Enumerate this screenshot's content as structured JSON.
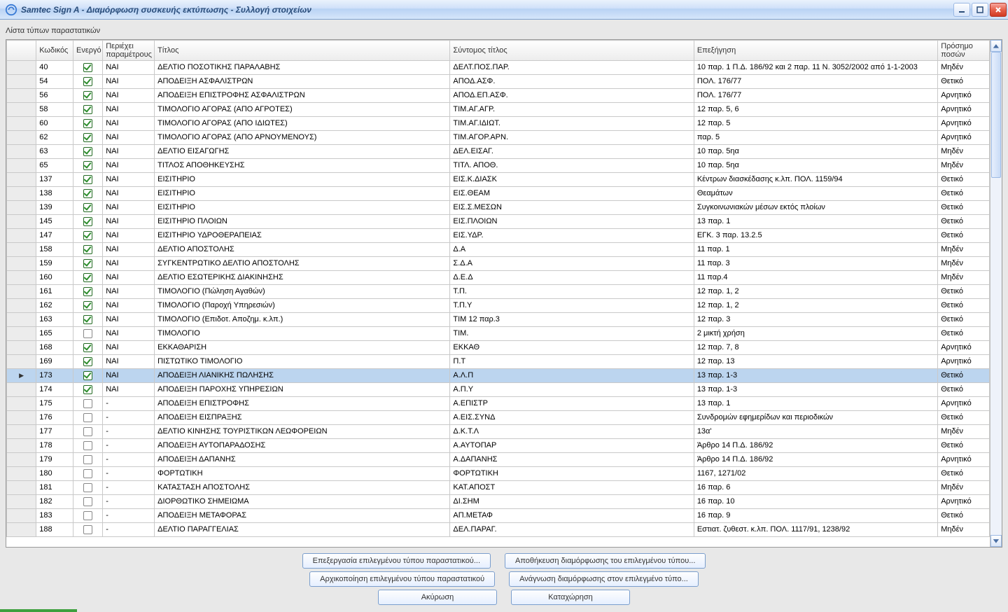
{
  "window": {
    "title": "Samtec Sign A - Διαμόρφωση συσκευής εκτύπωσης - Συλλογή στοιχείων"
  },
  "labels": {
    "list_title": "Λίστα τύπων παραστατικών"
  },
  "columns": {
    "code": "Κωδικός",
    "active": "Ενεργό",
    "has_params": "Περιέχει παραμέτρους",
    "title": "Τίτλος",
    "short": "Σύντομος τίτλος",
    "expl": "Επεξήγηση",
    "sign": "Πρόσημο ποσών"
  },
  "rows": [
    {
      "code": "40",
      "active": true,
      "has": "ΝΑΙ",
      "title": "ΔΕΛΤΙΟ ΠΟΣΟΤΙΚΗΣ ΠΑΡΑΛΑΒΗΣ",
      "short": "ΔΕΛΤ.ΠΟΣ.ΠΑΡ.",
      "expl": "10 παρ. 1 Π.Δ. 186/92 και 2 παρ. 11 Ν. 3052/2002 από 1-1-2003",
      "sign": "Μηδέν"
    },
    {
      "code": "54",
      "active": true,
      "has": "ΝΑΙ",
      "title": "ΑΠΟΔΕΙΞΗ ΑΣΦΑΛΙΣΤΡΩΝ",
      "short": "ΑΠΟΔ.ΑΣΦ.",
      "expl": "ΠΟΛ. 176/77",
      "sign": "Θετικό"
    },
    {
      "code": "56",
      "active": true,
      "has": "ΝΑΙ",
      "title": "ΑΠΟΔΕΙΞΗ ΕΠΙΣΤΡΟΦΗΣ ΑΣΦΑΛΙΣΤΡΩΝ",
      "short": "ΑΠΟΔ.ΕΠ.ΑΣΦ.",
      "expl": "ΠΟΛ. 176/77",
      "sign": "Αρνητικό"
    },
    {
      "code": "58",
      "active": true,
      "has": "ΝΑΙ",
      "title": "ΤΙΜΟΛΟΓΙΟ ΑΓΟΡΑΣ (ΑΠΟ ΑΓΡΟΤΕΣ)",
      "short": "ΤΙΜ.ΑΓ.ΑΓΡ.",
      "expl": "12 παρ. 5, 6",
      "sign": "Αρνητικό"
    },
    {
      "code": "60",
      "active": true,
      "has": "ΝΑΙ",
      "title": "ΤΙΜΟΛΟΓΙΟ ΑΓΟΡΑΣ (ΑΠΟ ΙΔΙΩΤΕΣ)",
      "short": "ΤΙΜ.ΑΓ.ΙΔΙΩΤ.",
      "expl": "12 παρ. 5",
      "sign": "Αρνητικό"
    },
    {
      "code": "62",
      "active": true,
      "has": "ΝΑΙ",
      "title": "ΤΙΜΟΛΟΓΙΟ ΑΓΟΡΑΣ (ΑΠΟ ΑΡΝΟΥΜΕΝΟΥΣ)",
      "short": "ΤΙΜ.ΑΓΟΡ.ΑΡΝ.",
      "expl": "παρ. 5",
      "sign": "Αρνητικό"
    },
    {
      "code": "63",
      "active": true,
      "has": "ΝΑΙ",
      "title": "ΔΕΛΤΙΟ ΕΙΣΑΓΩΓΗΣ",
      "short": "ΔΕΛ.ΕΙΣΑΓ.",
      "expl": "10 παρ. 5ηα",
      "sign": "Μηδέν"
    },
    {
      "code": "65",
      "active": true,
      "has": "ΝΑΙ",
      "title": "ΤΙΤΛΟΣ ΑΠΟΘΗΚΕΥΣΗΣ",
      "short": "ΤΙΤΛ. ΑΠΟΘ.",
      "expl": "10 παρ. 5ηα",
      "sign": "Μηδέν"
    },
    {
      "code": "137",
      "active": true,
      "has": "ΝΑΙ",
      "title": "ΕΙΣΙΤΗΡΙΟ",
      "short": "ΕΙΣ.Κ.ΔΙΑΣΚ",
      "expl": "Κέντρων διασκέδασης κ.λπ. ΠΟΛ. 1159/94",
      "sign": "Θετικό"
    },
    {
      "code": "138",
      "active": true,
      "has": "ΝΑΙ",
      "title": "ΕΙΣΙΤΗΡΙΟ",
      "short": "ΕΙΣ.ΘΕΑΜ",
      "expl": "Θεαμάτων",
      "sign": "Θετικό"
    },
    {
      "code": "139",
      "active": true,
      "has": "ΝΑΙ",
      "title": "ΕΙΣΙΤΗΡΙΟ",
      "short": "ΕΙΣ.Σ.ΜΕΣΩΝ",
      "expl": "Συγκοινωνιακών μέσων εκτός πλοίων",
      "sign": "Θετικό"
    },
    {
      "code": "145",
      "active": true,
      "has": "ΝΑΙ",
      "title": "ΕΙΣΙΤΗΡΙΟ ΠΛΟΙΩΝ",
      "short": "ΕΙΣ.ΠΛΟΙΩΝ",
      "expl": "13 παρ. 1",
      "sign": "Θετικό"
    },
    {
      "code": "147",
      "active": true,
      "has": "ΝΑΙ",
      "title": "ΕΙΣΙΤΗΡΙΟ ΥΔΡΟΘΕΡΑΠΕΙΑΣ",
      "short": "ΕΙΣ.ΥΔΡ.",
      "expl": "ΕΓΚ. 3 παρ. 13.2.5",
      "sign": "Θετικό"
    },
    {
      "code": "158",
      "active": true,
      "has": "ΝΑΙ",
      "title": "ΔΕΛΤΙΟ ΑΠΟΣΤΟΛΗΣ",
      "short": "Δ.Α",
      "expl": "11 παρ. 1",
      "sign": "Μηδέν"
    },
    {
      "code": "159",
      "active": true,
      "has": "ΝΑΙ",
      "title": "ΣΥΓΚΕΝΤΡΩΤΙΚΟ ΔΕΛΤΙΟ ΑΠΟΣΤΟΛΗΣ",
      "short": "Σ.Δ.Α",
      "expl": "11 παρ. 3",
      "sign": "Μηδέν"
    },
    {
      "code": "160",
      "active": true,
      "has": "ΝΑΙ",
      "title": "ΔΕΛΤΙΟ ΕΣΩΤΕΡΙΚΗΣ ΔΙΑΚΙΝΗΣΗΣ",
      "short": "Δ.Ε.Δ",
      "expl": "11 παρ.4",
      "sign": "Μηδέν"
    },
    {
      "code": "161",
      "active": true,
      "has": "ΝΑΙ",
      "title": "ΤΙΜΟΛΟΓΙΟ (Πώληση Αγαθών)",
      "short": "Τ.Π.",
      "expl": "12 παρ. 1, 2",
      "sign": "Θετικό"
    },
    {
      "code": "162",
      "active": true,
      "has": "ΝΑΙ",
      "title": "ΤΙΜΟΛΟΓΙΟ (Παροχή Υπηρεσιών)",
      "short": "Τ.Π.Υ",
      "expl": "12 παρ. 1, 2",
      "sign": "Θετικό"
    },
    {
      "code": "163",
      "active": true,
      "has": "ΝΑΙ",
      "title": "ΤΙΜΟΛΟΓΙΟ (Επιδοτ. Αποζημ. κ.λπ.)",
      "short": "ΤΙΜ 12 παρ.3",
      "expl": "12 παρ. 3",
      "sign": "Θετικό"
    },
    {
      "code": "165",
      "active": false,
      "has": "ΝΑΙ",
      "title": "ΤΙΜΟΛΟΓΙΟ",
      "short": "ΤΙΜ.",
      "expl": "2 μικτή χρήση",
      "sign": "Θετικό"
    },
    {
      "code": "168",
      "active": true,
      "has": "ΝΑΙ",
      "title": "ΕΚΚΑΘΑΡΙΣΗ",
      "short": "ΕΚΚΑΘ",
      "expl": "12 παρ. 7, 8",
      "sign": "Αρνητικό"
    },
    {
      "code": "169",
      "active": true,
      "has": "ΝΑΙ",
      "title": "ΠΙΣΤΩΤΙΚΟ ΤΙΜΟΛΟΓΙΟ",
      "short": "Π.Τ",
      "expl": "12 παρ. 13",
      "sign": "Αρνητικό"
    },
    {
      "code": "173",
      "active": true,
      "has": "ΝΑΙ",
      "title": "ΑΠΟΔΕΙΞΗ ΛΙΑΝΙΚΗΣ ΠΩΛΗΣΗΣ",
      "short": "Α.Λ.Π",
      "expl": "13 παρ. 1-3",
      "sign": "Θετικό",
      "selected": true
    },
    {
      "code": "174",
      "active": true,
      "has": "ΝΑΙ",
      "title": "ΑΠΟΔΕΙΞΗ ΠΑΡΟΧΗΣ ΥΠΗΡΕΣΙΩΝ",
      "short": "Α.Π.Υ",
      "expl": "13 παρ. 1-3",
      "sign": "Θετικό"
    },
    {
      "code": "175",
      "active": false,
      "has": "-",
      "title": "ΑΠΟΔΕΙΞΗ ΕΠΙΣΤΡΟΦΗΣ",
      "short": "Α.ΕΠΙΣΤΡ",
      "expl": "13 παρ. 1",
      "sign": "Αρνητικό"
    },
    {
      "code": "176",
      "active": false,
      "has": "-",
      "title": "ΑΠΟΔΕΙΞΗ ΕΙΣΠΡΑΞΗΣ",
      "short": "Α.ΕΙΣ.ΣΥΝΔ",
      "expl": "Συνδρομών εφημερίδων και περιοδικών",
      "sign": "Θετικό"
    },
    {
      "code": "177",
      "active": false,
      "has": "-",
      "title": "ΔΕΛΤΙΟ ΚΙΝΗΣΗΣ ΤΟΥΡΙΣΤΙΚΩΝ ΛΕΩΦΟΡΕΙΩΝ",
      "short": "Δ.Κ.Τ.Λ",
      "expl": "13α'",
      "sign": "Μηδέν"
    },
    {
      "code": "178",
      "active": false,
      "has": "-",
      "title": "ΑΠΟΔΕΙΞΗ ΑΥΤΟΠΑΡΑΔΟΣΗΣ",
      "short": "Α.ΑΥΤΟΠΑΡ",
      "expl": "Άρθρο 14 Π.Δ. 186/92",
      "sign": "Θετικό"
    },
    {
      "code": "179",
      "active": false,
      "has": "-",
      "title": "ΑΠΟΔΕΙΞΗ ΔΑΠΑΝΗΣ",
      "short": "Α.ΔΑΠΑΝΗΣ",
      "expl": "Άρθρο 14 Π.Δ. 186/92",
      "sign": "Αρνητικό"
    },
    {
      "code": "180",
      "active": false,
      "has": "-",
      "title": "ΦΟΡΤΩΤΙΚΗ",
      "short": "ΦΟΡΤΩΤΙΚΗ",
      "expl": "1167, 1271/02",
      "sign": "Θετικό"
    },
    {
      "code": "181",
      "active": false,
      "has": "-",
      "title": "ΚΑΤΑΣΤΑΣΗ ΑΠΟΣΤΟΛΗΣ",
      "short": "ΚΑΤ.ΑΠΟΣΤ",
      "expl": "16 παρ. 6",
      "sign": "Μηδέν"
    },
    {
      "code": "182",
      "active": false,
      "has": "-",
      "title": "ΔΙΟΡΘΩΤΙΚΟ ΣΗΜΕΙΩΜΑ",
      "short": "ΔΙ.ΣΗΜ",
      "expl": "16 παρ. 10",
      "sign": "Αρνητικό"
    },
    {
      "code": "183",
      "active": false,
      "has": "-",
      "title": "ΑΠΟΔΕΙΞΗ ΜΕΤΑΦΟΡΑΣ",
      "short": "ΑΠ.ΜΕΤΑΦ",
      "expl": "16 παρ. 9",
      "sign": "Θετικό"
    },
    {
      "code": "188",
      "active": false,
      "has": "-",
      "title": "ΔΕΛΤΙΟ ΠΑΡΑΓΓΕΛΙΑΣ",
      "short": "ΔΕΛ.ΠΑΡΑΓ.",
      "expl": "Εστιατ. ζυθεστ. κ.λπ. ΠΟΛ. 1117/91, 1238/92",
      "sign": "Μηδέν"
    }
  ],
  "buttons": {
    "edit": "Επεξεργασία επιλεγμένου τύπου παραστατικού...",
    "save": "Αποθήκευση διαμόρφωσης του επιλεγμένου τύπου...",
    "init": "Αρχικοποίηση επιλεγμένου τύπου παραστατικού",
    "read": "Ανάγνωση διαμόρφωσης στον επιλεγμένο τύπο...",
    "cancel": "Ακύρωση",
    "submit": "Καταχώρηση"
  }
}
